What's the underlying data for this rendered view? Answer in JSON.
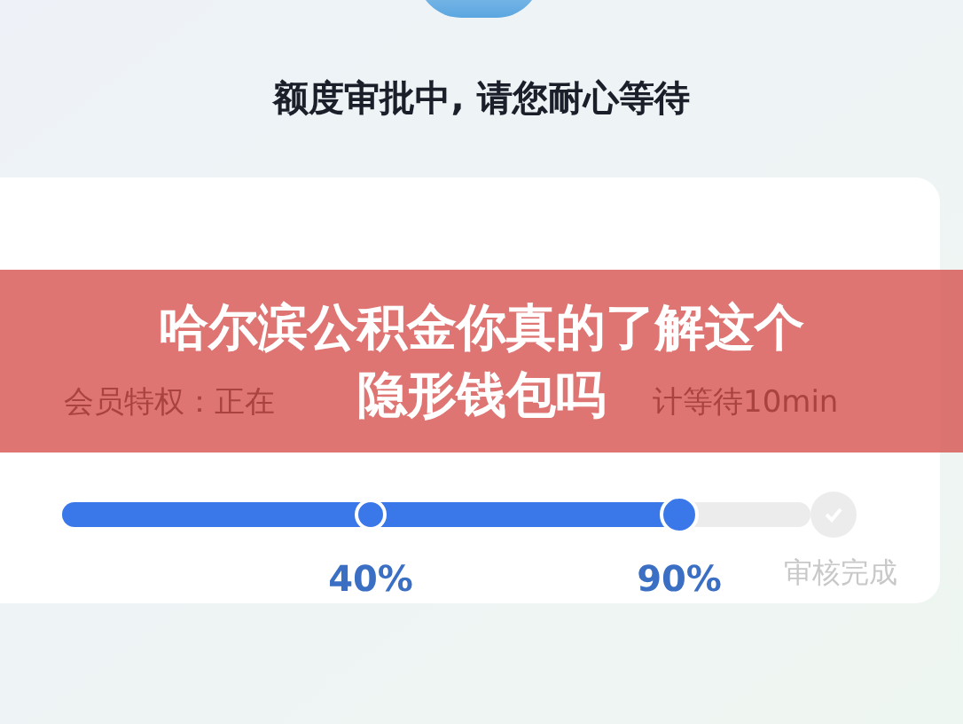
{
  "status_title": "额度审批中, 请您耐心等待",
  "membership": {
    "text_left": "会员特权：正在",
    "text_right": "计等待10min"
  },
  "progress": {
    "level": 0.8,
    "steps": [
      {
        "label": "40%",
        "kind": "dot",
        "done": true
      },
      {
        "label": "90%",
        "kind": "thumb",
        "done": true
      },
      {
        "label": "审核完成",
        "kind": "check",
        "done": false
      }
    ]
  },
  "banner": {
    "title_lines": [
      "哈尔滨公积金你真的了解这个",
      "隐形钱包吗"
    ]
  }
}
